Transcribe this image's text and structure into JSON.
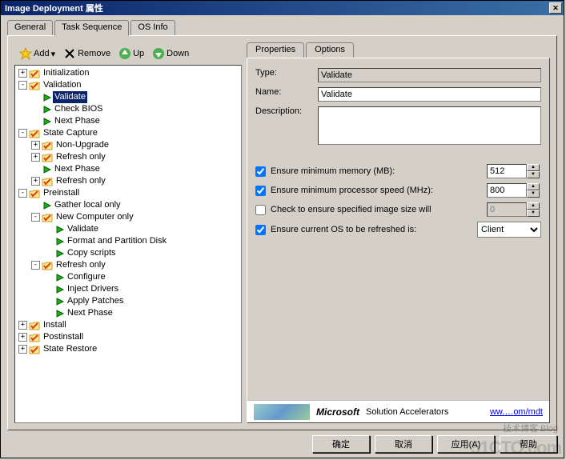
{
  "window": {
    "title": "Image Deployment 属性"
  },
  "tabs_outer": [
    "General",
    "Task Sequence",
    "OS Info"
  ],
  "toolbar": {
    "add": "Add",
    "remove": "Remove",
    "up": "Up",
    "down": "Down"
  },
  "tree": {
    "Initialization": {},
    "Validation": {
      "children": [
        "Validate",
        "Check BIOS",
        "Next Phase"
      ],
      "selected": 0
    },
    "State Capture": {
      "children": [
        "Non-Upgrade",
        "Refresh only",
        "Next Phase",
        "Refresh only"
      ]
    },
    "Preinstall": {
      "children": [
        "Gather local only",
        {
          "label": "New Computer only",
          "children": [
            "Validate",
            "Format and Partition Disk",
            "Copy scripts"
          ]
        },
        {
          "label": "Refresh only",
          "children": [
            "Configure",
            "Inject Drivers",
            "Apply Patches",
            "Next Phase"
          ]
        }
      ]
    },
    "Install": {},
    "Postinstall": {},
    "State Restore": {}
  },
  "right_tabs": [
    "Properties",
    "Options"
  ],
  "form": {
    "type_label": "Type:",
    "type_value": "Validate",
    "name_label": "Name:",
    "name_value": "Validate",
    "desc_label": "Description:",
    "desc_value": ""
  },
  "checks": {
    "mem_label": "Ensure minimum memory (MB):",
    "mem_checked": true,
    "mem_value": "512",
    "cpu_label": "Ensure minimum processor speed (MHz):",
    "cpu_checked": true,
    "cpu_value": "800",
    "img_label": "Check to ensure specified image size will",
    "img_checked": false,
    "img_value": "0",
    "os_label": "Ensure current OS to be refreshed is:",
    "os_checked": true,
    "os_value": "Client"
  },
  "footer": {
    "ms": "Microsoft",
    "sol": "Solution Accelerators",
    "link_prefix": "ww.",
    "link_suffix": "om/mdt"
  },
  "buttons": {
    "ok": "确定",
    "cancel": "取消",
    "apply": "应用(A)",
    "help": "帮助"
  },
  "watermark": {
    "main": "51CTO.com",
    "sub1": "技术博客",
    "sub2": "Blog"
  }
}
